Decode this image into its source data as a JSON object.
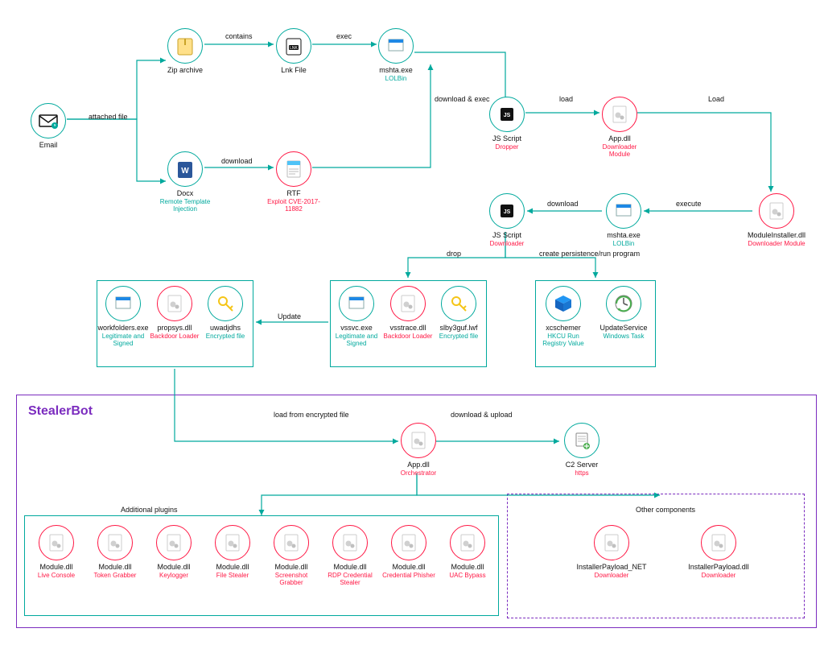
{
  "diagram_title": "StealerBot",
  "nodes": {
    "email": {
      "title": "Email",
      "sub": ""
    },
    "zip": {
      "title": "Zip archive",
      "sub": ""
    },
    "lnk": {
      "title": "Lnk File",
      "sub": ""
    },
    "mshta1": {
      "title": "mshta.exe",
      "sub": "LOLBin"
    },
    "docx": {
      "title": "Docx",
      "sub": "Remote Template Injection"
    },
    "rtf": {
      "title": "RTF",
      "sub": "Exploit CVE-2017-11882"
    },
    "jsdrop": {
      "title": "JS Script",
      "sub": "Dropper"
    },
    "appdll1": {
      "title": "App.dll",
      "sub": "Downloader Module"
    },
    "modinst": {
      "title": "ModuleInstaller.dll",
      "sub": "Downloader Module"
    },
    "mshta2": {
      "title": "mshta.exe",
      "sub": "LOLBin"
    },
    "jsdown": {
      "title": "JS Script",
      "sub": "Downloader"
    },
    "workfolders": {
      "title": "workfolders.exe",
      "sub": "Legitimate and Signed"
    },
    "propsys": {
      "title": "propsys.dll",
      "sub": "Backdoor Loader"
    },
    "uwadjdhs": {
      "title": "uwadjdhs",
      "sub": "Encrypted file"
    },
    "vssvc": {
      "title": "vssvc.exe",
      "sub": "Legitimate and Signed"
    },
    "vsstrace": {
      "title": "vsstrace.dll",
      "sub": "Backdoor Loader"
    },
    "slby": {
      "title": "slby3guf.lwf",
      "sub": "Encrypted file"
    },
    "xcschemer": {
      "title": "xcschemer",
      "sub": "HKCU Run Registry Value"
    },
    "updsvc": {
      "title": "UpdateService",
      "sub": "Windows Task"
    },
    "apporch": {
      "title": "App.dll",
      "sub": "Orchestrator"
    },
    "c2": {
      "title": "C2 Server",
      "sub": "https"
    },
    "m1": {
      "title": "Module.dll",
      "sub": "Live Console"
    },
    "m2": {
      "title": "Module.dll",
      "sub": "Token Grabber"
    },
    "m3": {
      "title": "Module.dll",
      "sub": "Keylogger"
    },
    "m4": {
      "title": "Module.dll",
      "sub": "File Stealer"
    },
    "m5": {
      "title": "Module.dll",
      "sub": "Screenshot Grabber"
    },
    "m6": {
      "title": "Module.dll",
      "sub": "RDP Credential Stealer"
    },
    "m7": {
      "title": "Module.dll",
      "sub": "Credential Phisher"
    },
    "m8": {
      "title": "Module.dll",
      "sub": "UAC Bypass"
    },
    "inst1": {
      "title": "InstallerPayload_NET",
      "sub": "Downloader"
    },
    "inst2": {
      "title": "InstallerPayload.dll",
      "sub": "Downloader"
    }
  },
  "edges": {
    "attached": "attached file",
    "contains": "contains",
    "exec": "exec",
    "download": "download",
    "dlexec": "download & exec",
    "load": "load",
    "Load": "Load",
    "execute": "execute",
    "download2": "download",
    "drop": "drop",
    "persist": "create persistence/run program",
    "update": "Update",
    "loadenc": "load from encrypted file",
    "dlup": "download & upload"
  },
  "sections": {
    "plugins": "Additional plugins",
    "other": "Other components"
  }
}
